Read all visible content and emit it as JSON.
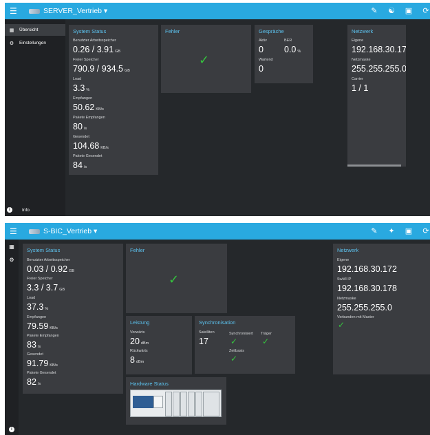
{
  "screen1": {
    "server_name": "SERVER_Vertrieb",
    "nav": [
      {
        "label": "Übersicht",
        "icon": "dashboard-icon"
      },
      {
        "label": "Einstellungen",
        "icon": "gear-icon"
      }
    ],
    "info_label": "Info",
    "system_status": {
      "title": "System Status",
      "stats": [
        {
          "label": "Benutzter Arbeitsspeicher",
          "value": "0.26 / 3.91",
          "unit": "GB"
        },
        {
          "label": "Freier Speicher",
          "value": "790.9 / 934.5",
          "unit": "GB"
        },
        {
          "label": "Load",
          "value": "3.3",
          "unit": "%"
        },
        {
          "label": "Empfangen",
          "value": "50.62",
          "unit": "KB/s"
        },
        {
          "label": "Pakete Empfangen",
          "value": "80",
          "unit": "/s"
        },
        {
          "label": "Gesendet",
          "value": "104.68",
          "unit": "KB/s"
        },
        {
          "label": "Pakete Gesendet",
          "value": "84",
          "unit": "/s"
        }
      ]
    },
    "fehler": {
      "title": "Fehler"
    },
    "gespraeche": {
      "title": "Gespräche",
      "aktiv_label": "Aktiv",
      "aktiv_value": "0",
      "ber_label": "BER",
      "ber_value": "0.0",
      "ber_unit": "%",
      "wartend_label": "Wartend",
      "wartend_value": "0"
    },
    "netzwerk": {
      "title": "Netzwerk",
      "eigene_label": "Eigene",
      "eigene_value": "192.168.30.172",
      "netzmaske_label": "Netzmaske",
      "netzmaske_value": "255.255.255.0",
      "carrier_label": "Carrier",
      "carrier_value": "1 / 1"
    }
  },
  "screen2": {
    "server_name": "S-BIC_Vertrieb",
    "system_status": {
      "title": "System Status",
      "stats": [
        {
          "label": "Benutzter Arbeitsspeicher",
          "value": "0.03 / 0.92",
          "unit": "GB"
        },
        {
          "label": "Freier Speicher",
          "value": "3.3 / 3.7",
          "unit": "GB"
        },
        {
          "label": "Load",
          "value": "37.3",
          "unit": "%"
        },
        {
          "label": "Empfangen",
          "value": "79.59",
          "unit": "KB/s"
        },
        {
          "label": "Pakete Empfangen",
          "value": "83",
          "unit": "/s"
        },
        {
          "label": "Gesendet",
          "value": "91.79",
          "unit": "KB/s"
        },
        {
          "label": "Pakete Gesendet",
          "value": "82",
          "unit": "/s"
        }
      ]
    },
    "fehler": {
      "title": "Fehler"
    },
    "leistung": {
      "title": "Leistung",
      "vorwaerts_label": "Vorwärts",
      "vorwaerts_value": "20",
      "vorwaerts_unit": "dBm",
      "rueckwaerts_label": "Rückwärts",
      "rueckwaerts_value": "8",
      "rueckwaerts_unit": "dBm"
    },
    "synchronisation": {
      "title": "Synchronisation",
      "satelliten_label": "Satelliten",
      "satelliten_value": "17",
      "synchronisiert_label": "Synchronisiert",
      "traeger_label": "Träger",
      "zeitbasis_label": "Zeitbasis"
    },
    "hardware": {
      "title": "Hardware Status"
    },
    "netzwerk": {
      "title": "Netzwerk",
      "eigene_label": "Eigene",
      "eigene_value": "192.168.30.172",
      "swmi_label": "SwMI IP",
      "swmi_value": "192.168.30.178",
      "netzmaske_label": "Netzmaske",
      "netzmaske_value": "255.255.255.0",
      "master_label": "Verbunden mit Master"
    }
  },
  "colors": {
    "topbar": "#29a9e0",
    "background": "#25282b",
    "card": "#3a3c40",
    "card_title": "#5cc3ef",
    "ok_check": "#35c43e"
  }
}
